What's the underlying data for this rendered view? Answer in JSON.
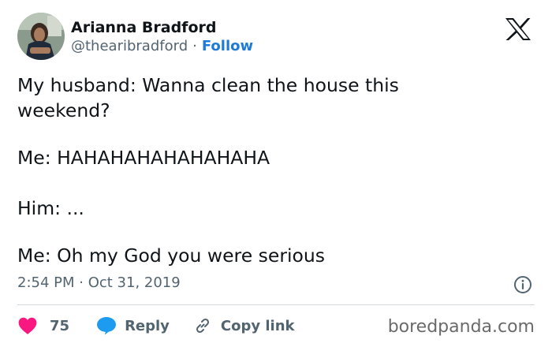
{
  "author": {
    "name": "Arianna Bradford",
    "handle": "@thearibradford",
    "separator": "·",
    "follow_label": "Follow"
  },
  "icons": {
    "avatar": "profile-photo",
    "logo": "x-logo",
    "info": "info-icon",
    "like": "heart-icon",
    "reply": "speech-bubble-icon",
    "copy": "link-icon"
  },
  "tweet": {
    "lines": [
      "My husband: Wanna clean the house this",
      "weekend?",
      "Me: HAHAHAHAHAHAHAHA",
      "Him: ...",
      "Me: Oh my God you were serious"
    ],
    "timestamp": "2:54 PM · Oct 31, 2019"
  },
  "actions": {
    "likes": "75",
    "reply_label": "Reply",
    "copy_label": "Copy link"
  },
  "watermark": "boredpanda.com",
  "colors": {
    "like": "#f91880",
    "reply": "#1d9bf0",
    "follow": "#1d7ad8",
    "muted": "#536471",
    "text": "#0f1419"
  }
}
